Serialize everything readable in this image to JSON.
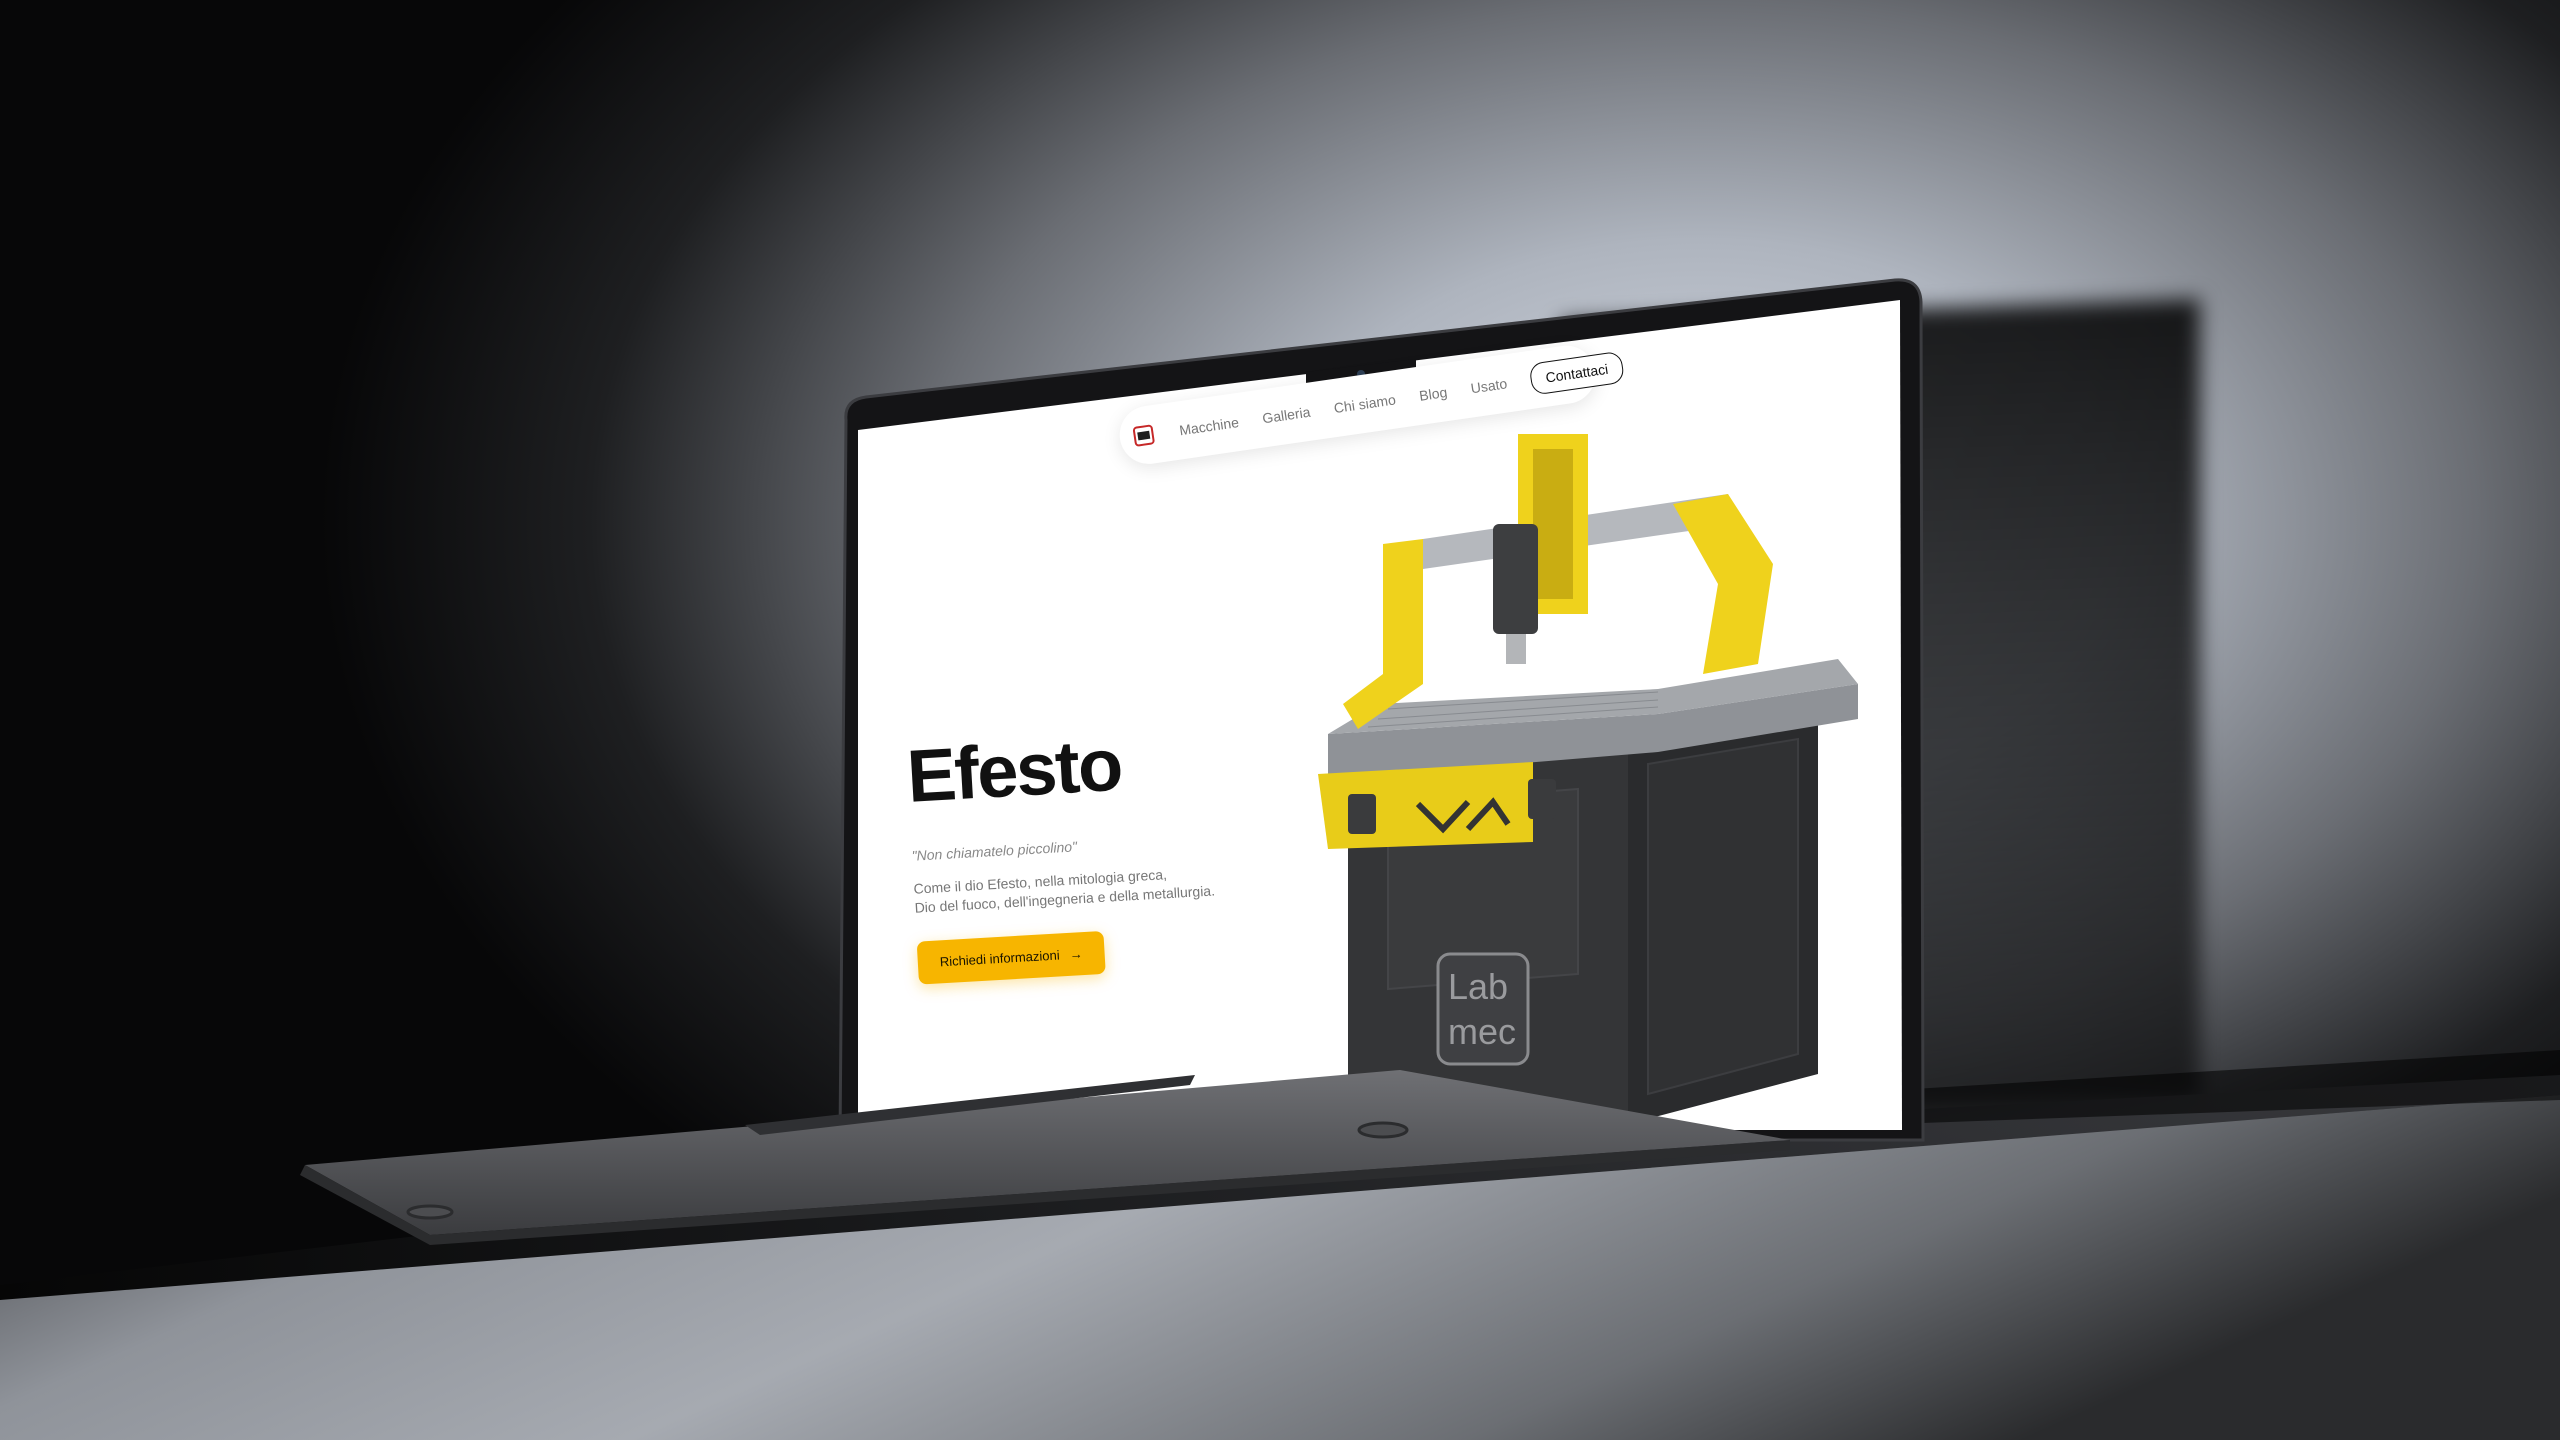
{
  "nav": {
    "items": [
      "Macchine",
      "Galleria",
      "Chi siamo",
      "Blog",
      "Usato"
    ],
    "cta": "Contattaci"
  },
  "hero": {
    "title": "Efesto",
    "quote": "\"Non chiamatelo piccolino\"",
    "description_line1": "Come il dio Efesto, nella mitologia greca,",
    "description_line2": "Dio del fuoco, dell'ingegneria e della metallurgia.",
    "button_label": "Richiedi informazioni",
    "button_icon": "arrow-right-icon"
  },
  "machine": {
    "badge_line1": "Lab",
    "badge_line2": "mec"
  },
  "colors": {
    "accent_yellow": "#f7b500",
    "machine_yellow": "#f2d21a",
    "machine_dark": "#3a3b3d",
    "screen_bg": "#ffffff"
  }
}
